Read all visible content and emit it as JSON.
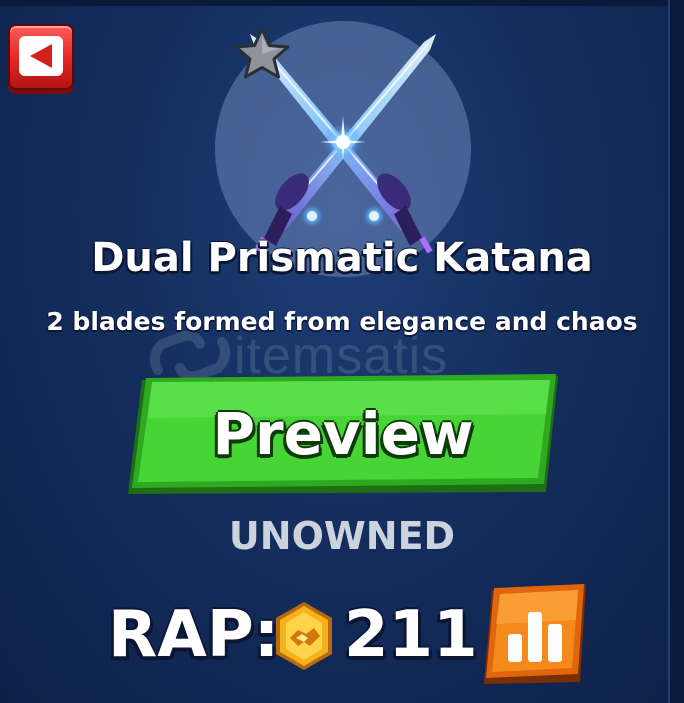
{
  "item": {
    "name": "Dual Prismatic Katana",
    "description": "2 blades formed from elegance and chaos",
    "rarity_icon": "silver-star-icon"
  },
  "actions": {
    "back_icon": "back-arrow-icon",
    "preview_label": "Preview",
    "stats_icon": "bar-chart-icon"
  },
  "ownership": {
    "status": "UNOWNED"
  },
  "rap": {
    "label": "RAP:",
    "currency_icon": "handshake-coin-icon",
    "value": "211"
  },
  "watermark": {
    "text": "itemsatis"
  },
  "colors": {
    "background": "#142e5e",
    "preview_green": "#3fcf2f",
    "back_red": "#e42525",
    "stats_orange": "#f07a12",
    "coin_gold": "#f5b21b",
    "status_gray": "#cdd3dd"
  }
}
